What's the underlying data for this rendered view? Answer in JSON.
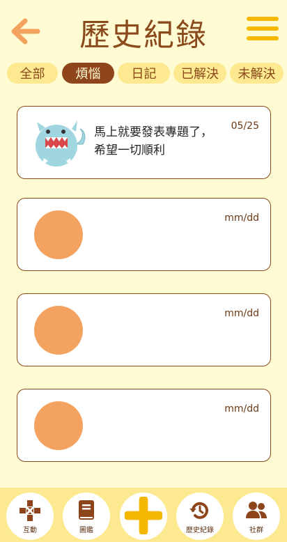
{
  "header": {
    "title": "歷史紀錄",
    "back_icon": "back-arrow-icon",
    "menu_icon": "menu-icon"
  },
  "tabs": [
    {
      "label": "全部",
      "active": false
    },
    {
      "label": "煩惱",
      "active": true
    },
    {
      "label": "日記",
      "active": false
    },
    {
      "label": "已解決",
      "active": false
    },
    {
      "label": "未解決",
      "active": false
    }
  ],
  "entries": [
    {
      "date": "05/25",
      "text": "馬上就要發表專題了，希望一切順利",
      "avatar": "monster-mascot"
    },
    {
      "date": "mm/dd",
      "text": "",
      "avatar": "placeholder-circle"
    },
    {
      "date": "mm/dd",
      "text": "",
      "avatar": "placeholder-circle"
    },
    {
      "date": "mm/dd",
      "text": "",
      "avatar": "placeholder-circle"
    }
  ],
  "bottom_nav": [
    {
      "label": "互動",
      "icon": "gamepad-icon"
    },
    {
      "label": "圖鑑",
      "icon": "book-icon"
    },
    {
      "label": "",
      "icon": "plus-icon"
    },
    {
      "label": "歷史紀錄",
      "icon": "history-icon"
    },
    {
      "label": "社群",
      "icon": "users-icon"
    }
  ],
  "colors": {
    "background": "#fffbd3",
    "brown": "#8a4a1c",
    "tab_bg": "#fde98f",
    "active_tab": "#8e451b",
    "accent_yellow": "#f5b800",
    "orange": "#f3a35f"
  }
}
